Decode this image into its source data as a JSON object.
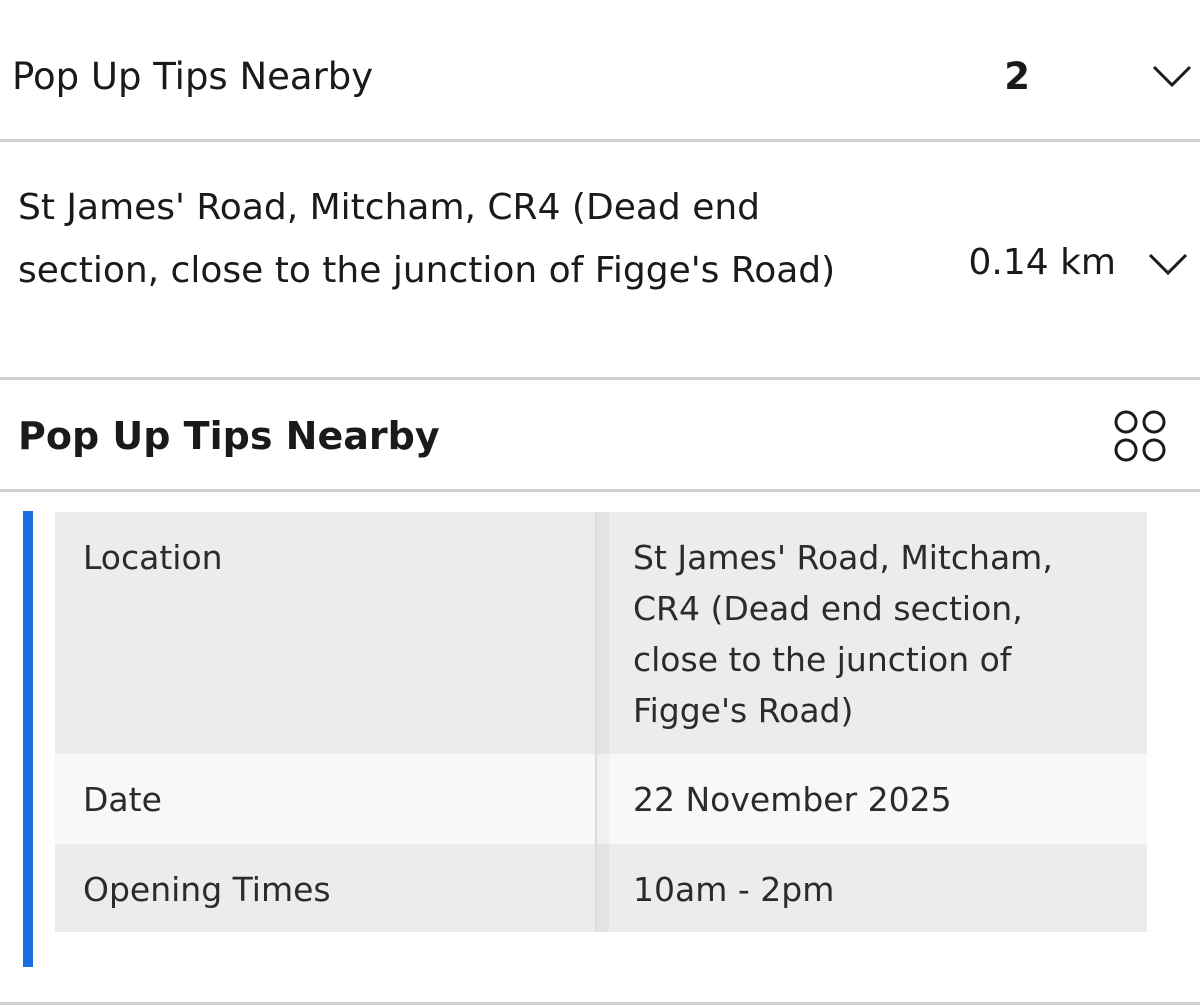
{
  "summary": {
    "title": "Pop Up Tips Nearby",
    "count": "2",
    "toggle_icon": "chevron-down-icon"
  },
  "result": {
    "address": "St James' Road, Mitcham, CR4 (Dead end section, close to the junction of Figge's Road)",
    "distance": "0.14 km",
    "toggle_icon": "chevron-down-icon"
  },
  "details": {
    "title": "Pop Up Tips Nearby",
    "view_icon": "grid-icon",
    "accent_color": "#1a6fe0",
    "rows": [
      {
        "label": "Location",
        "value": "St James' Road, Mitcham, CR4 (Dead end section, close to the junction of Figge's Road)"
      },
      {
        "label": "Date",
        "value": "22 November 2025"
      },
      {
        "label": "Opening Times",
        "value": "10am - 2pm"
      }
    ]
  }
}
